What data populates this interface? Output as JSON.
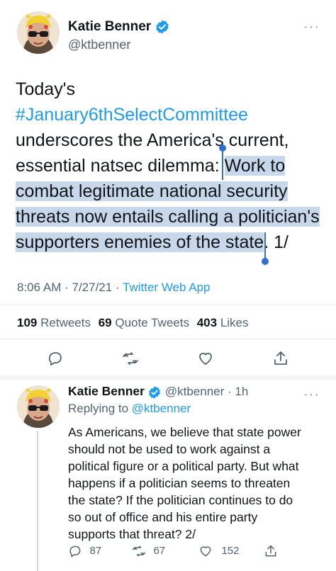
{
  "main_tweet": {
    "author_name": "Katie Benner",
    "author_handle": "@ktbenner",
    "more": "···",
    "text_line1": "Today's",
    "hashtag": "#January6thSelectCommittee",
    "text_line3": "underscores the America's current,",
    "text_line4_pre": "essential natsec dilemma: ",
    "sel_line4": "Work to",
    "sel_line5": "combat legitimate national security",
    "sel_line6": "threats now entails calling a politician's",
    "sel_line7": "supporters enemies of the state",
    "text_line7_post": ". 1/",
    "time": "8:06 AM",
    "date": "7/27/21",
    "source": "Twitter Web App",
    "retweets_count": "109",
    "retweets_label": "Retweets",
    "quotes_count": "69",
    "quotes_label": "Quote Tweets",
    "likes_count": "403",
    "likes_label": "Likes"
  },
  "reply_tweet": {
    "author_name": "Katie Benner",
    "author_handle": "@ktbenner",
    "time_ago": "1h",
    "replying_prefix": "Replying to",
    "replying_to": "@ktbenner",
    "more": "···",
    "lines": [
      "As Americans, we believe that state power",
      "should not be used to work against a",
      "political figure or a political party. But what",
      "happens if a politician seems to threaten",
      "the state? If the politician continues to do",
      "so out of office and his entire party",
      "supports that threat? 2/"
    ],
    "reply_count": "87",
    "retweet_count": "67",
    "like_count": "152"
  },
  "colors": {
    "accent": "#1d9bf0",
    "selection": "#c9d7ea",
    "caret": "#2f6fd1"
  }
}
